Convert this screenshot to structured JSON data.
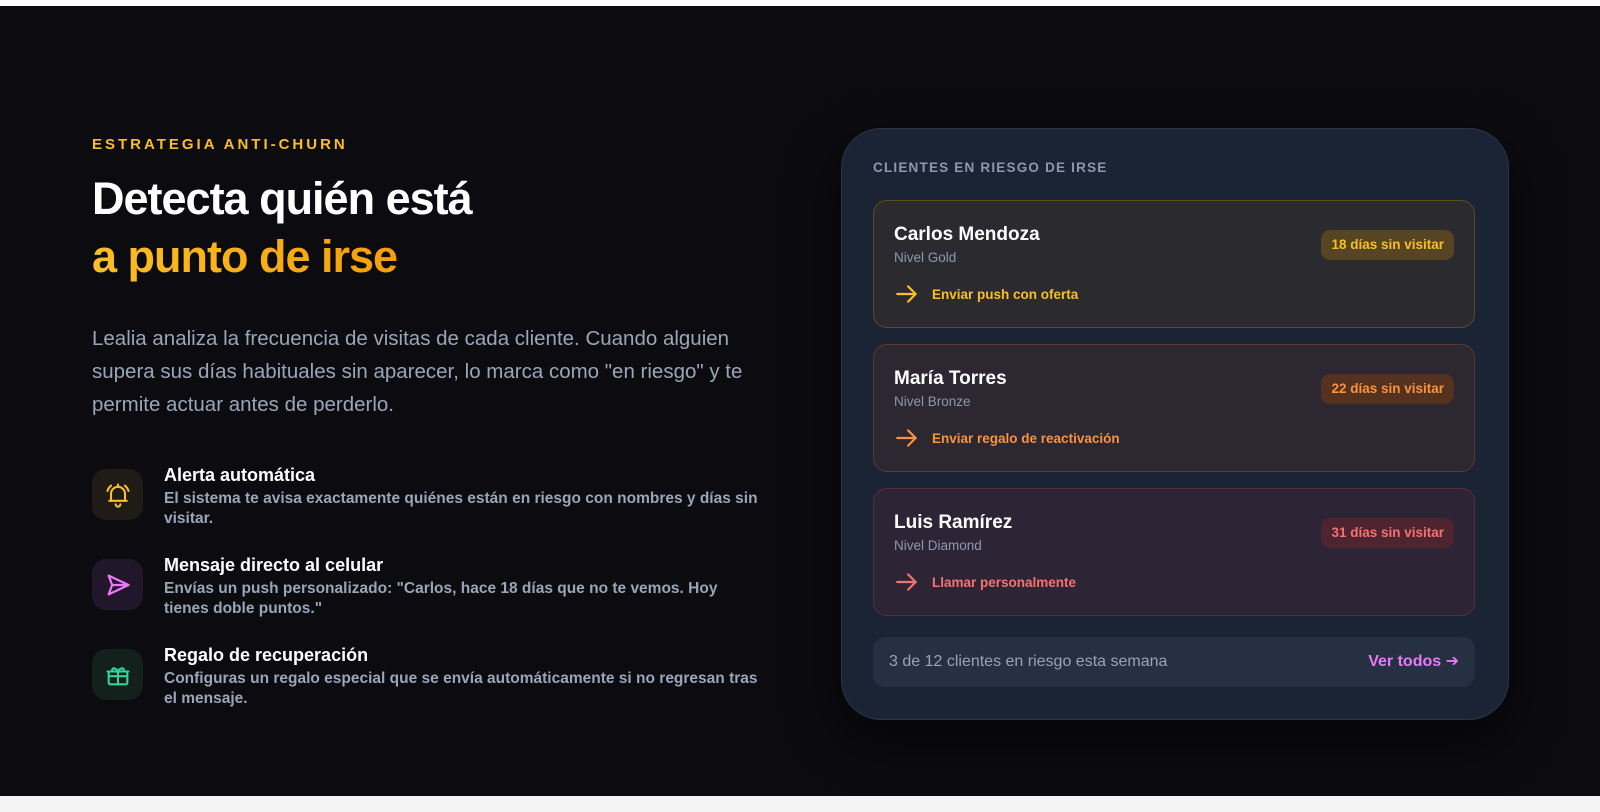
{
  "section": {
    "eyebrow": "ESTRATEGIA ANTI-CHURN",
    "headline_line1": "Detecta quién está",
    "headline_line2": "a punto de irse",
    "lead": "Lealia analiza la frecuencia de visitas de cada cliente. Cuando alguien supera sus días habituales sin aparecer, lo marca como \"en riesgo\" y te permite actuar antes de perderlo."
  },
  "features": [
    {
      "icon": "bell-icon",
      "color": "#fbbf24",
      "title": "Alerta automática",
      "description": "El sistema te avisa exactamente quiénes están en riesgo con nombres y días sin visitar."
    },
    {
      "icon": "send-icon",
      "color": "#e879f9",
      "title": "Mensaje directo al celular",
      "description": "Envías un push personalizado: \"Carlos, hace 18 días que no te vemos. Hoy tienes doble puntos.\""
    },
    {
      "icon": "gift-icon",
      "color": "#34d399",
      "title": "Regalo de recuperación",
      "description": "Configuras un regalo especial que se envía automáticamente si no regresan tras el mensaje."
    }
  ],
  "card": {
    "title": "CLIENTES EN RIESGO DE IRSE",
    "clients": [
      {
        "name": "Carlos Mendoza",
        "level": "Nivel Gold",
        "badge": "18 días sin visitar",
        "action": "Enviar push con oferta",
        "color": "#fbbf24"
      },
      {
        "name": "María Torres",
        "level": "Nivel Bronze",
        "badge": "22 días sin visitar",
        "action": "Enviar regalo de reactivación",
        "color": "#fb923c"
      },
      {
        "name": "Luis Ramírez",
        "level": "Nivel Diamond",
        "badge": "31 días sin visitar",
        "action": "Llamar personalmente",
        "color": "#f87171"
      }
    ],
    "footer_text": "3 de 12 clientes en riesgo esta semana",
    "footer_link": "Ver todos ➔"
  }
}
